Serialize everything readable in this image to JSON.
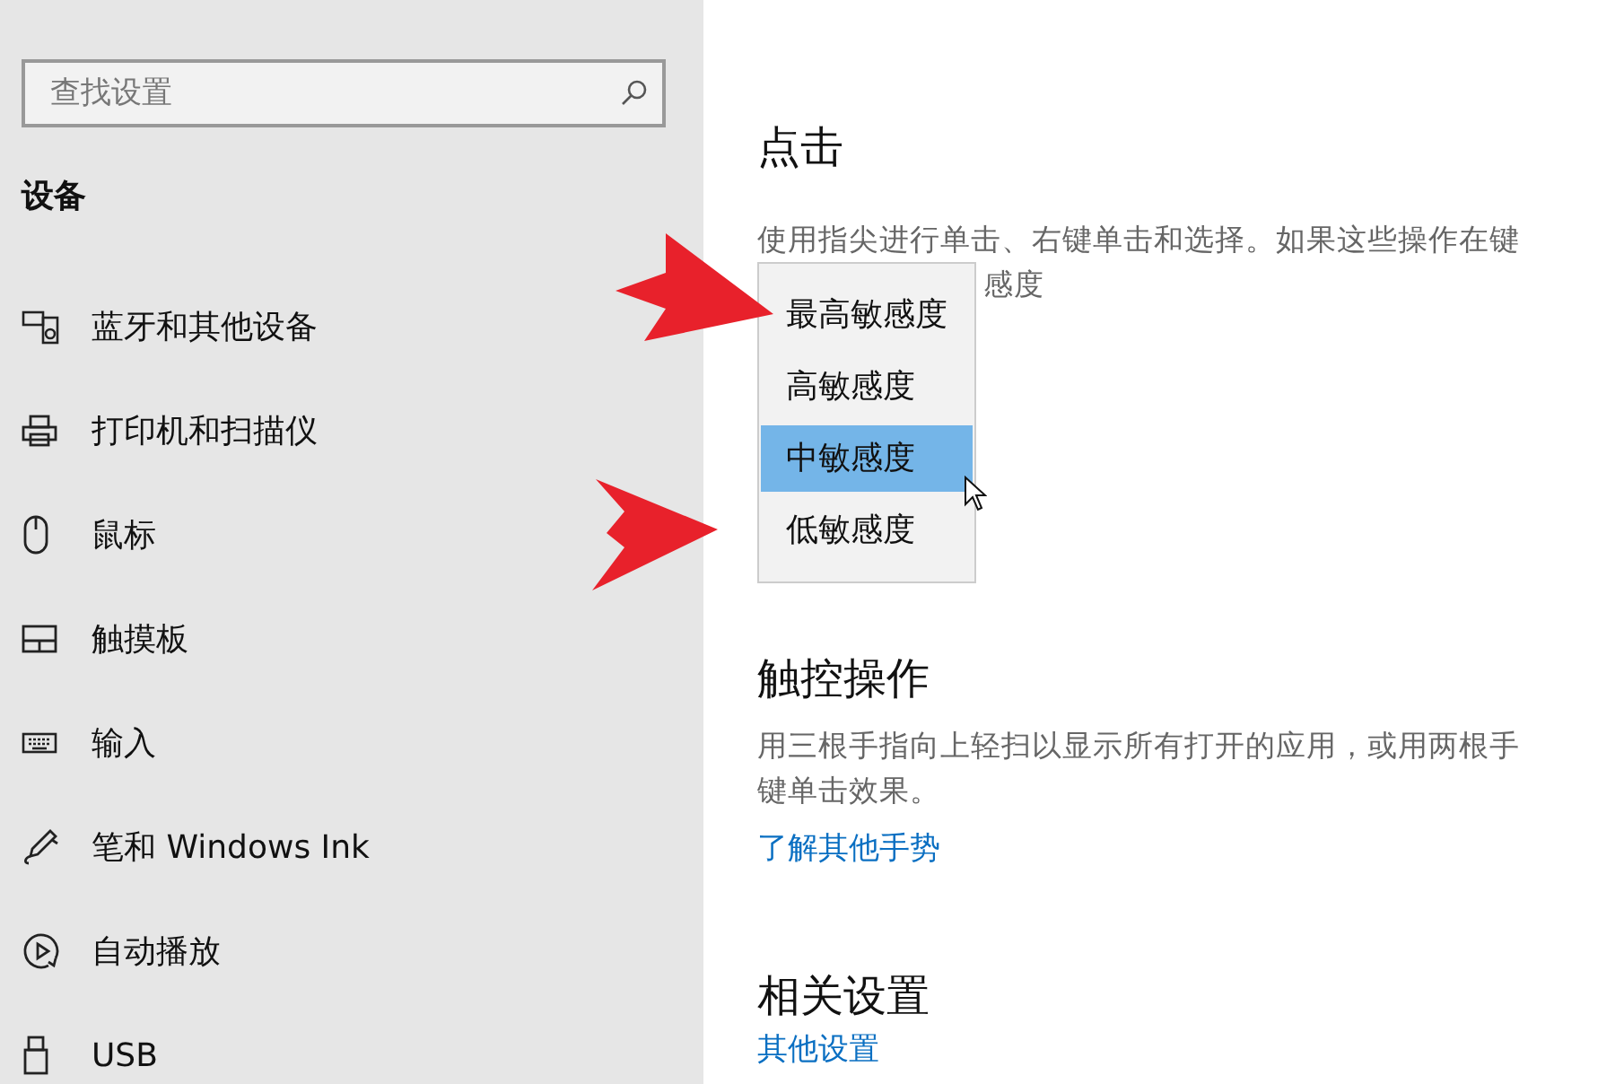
{
  "sidebar": {
    "search": {
      "placeholder": "查找设置"
    },
    "section_title": "设备",
    "items": [
      {
        "label": "蓝牙和其他设备"
      },
      {
        "label": "打印机和扫描仪"
      },
      {
        "label": "鼠标"
      },
      {
        "label": "触摸板"
      },
      {
        "label": "输入"
      },
      {
        "label": "笔和 Windows Ink"
      },
      {
        "label": "自动播放"
      },
      {
        "label": "USB"
      }
    ]
  },
  "sections": [
    {
      "kind": "tap",
      "heading": "点击",
      "description_lines": [
        "使用指尖进行单击、右键单击和选择。如果这些操作在键",
        "感度"
      ],
      "dropdown": {
        "options": [
          {
            "label": "最高敏感度",
            "selected": false
          },
          {
            "label": "高敏感度",
            "selected": false
          },
          {
            "label": "中敏感度",
            "selected": true
          },
          {
            "label": "低敏感度",
            "selected": false
          }
        ]
      }
    },
    {
      "kind": "touch",
      "heading": "触控操作",
      "description_lines": [
        "用三根手指向上轻扫以显示所有打开的应用，或用两根手",
        "键单击效果。"
      ],
      "link": "了解其他手势"
    },
    {
      "kind": "related",
      "heading": "相关设置",
      "link": "其他设置"
    }
  ]
}
